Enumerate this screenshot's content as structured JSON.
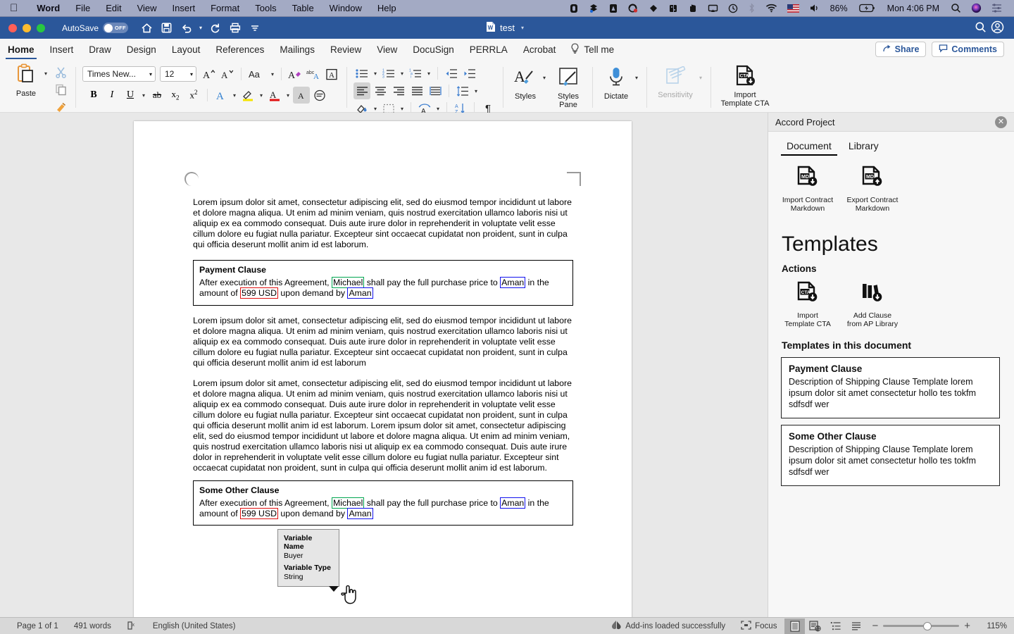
{
  "menubar": {
    "apple_icon": "apple-icon",
    "items": [
      {
        "label": "Word",
        "bold": true
      },
      {
        "label": "File",
        "bold": false
      },
      {
        "label": "Edit",
        "bold": false
      },
      {
        "label": "View",
        "bold": false
      },
      {
        "label": "Insert",
        "bold": false
      },
      {
        "label": "Format",
        "bold": false
      },
      {
        "label": "Tools",
        "bold": false
      },
      {
        "label": "Table",
        "bold": false
      },
      {
        "label": "Window",
        "bold": false
      },
      {
        "label": "Help",
        "bold": false
      }
    ],
    "status_icons": [
      "screen-recorder-icon",
      "dropbox-icon",
      "acrobat-icon",
      "cleanmymac-icon",
      "diamond-icon",
      "grid-icon",
      "evernote-icon",
      "airplay-icon",
      "time-machine-icon",
      "bluetooth-icon",
      "wifi-icon",
      "flag-us-icon",
      "volume-icon"
    ],
    "battery": "86%",
    "battery_icon": "battery-charging-icon",
    "clock": "Mon 4:06 PM",
    "spotlight_icon": "search-icon",
    "siri_icon": "siri-icon",
    "controlcenter_icon": "control-center-icon"
  },
  "titlebar": {
    "autosave_label": "AutoSave",
    "autosave_state": "OFF",
    "quick_access": [
      "home-icon",
      "save-icon",
      "undo-icon",
      "redo-icon",
      "print-icon",
      "more-icon"
    ],
    "document_name": "test",
    "document_icon": "word-document-icon",
    "search_icon": "search-icon",
    "account_icon": "account-icon",
    "bg_color": "#2b579a"
  },
  "ribbon_tabs": {
    "tabs": [
      {
        "label": "Home",
        "active": true
      },
      {
        "label": "Insert",
        "active": false
      },
      {
        "label": "Draw",
        "active": false
      },
      {
        "label": "Design",
        "active": false
      },
      {
        "label": "Layout",
        "active": false
      },
      {
        "label": "References",
        "active": false
      },
      {
        "label": "Mailings",
        "active": false
      },
      {
        "label": "Review",
        "active": false
      },
      {
        "label": "View",
        "active": false
      },
      {
        "label": "DocuSign",
        "active": false
      },
      {
        "label": "PERRLA",
        "active": false
      },
      {
        "label": "Acrobat",
        "active": false
      }
    ],
    "tell_me": "Tell me",
    "tell_me_icon": "lightbulb-icon",
    "share_label": "Share",
    "comments_label": "Comments"
  },
  "ribbon": {
    "paste_label": "Paste",
    "font_name": "Times New...",
    "font_size": "12",
    "styles_label": "Styles",
    "styles_pane_label": "Styles\nPane",
    "styles_pane_line1": "Styles",
    "styles_pane_line2": "Pane",
    "dictate_label": "Dictate",
    "sensitivity_label": "Sensitivity",
    "import_cta_line1": "Import",
    "import_cta_line2": "Template CTA"
  },
  "document": {
    "paragraphs": [
      "Lorem ipsum dolor sit amet, consectetur adipiscing elit, sed do eiusmod tempor incididunt ut labore et dolore magna aliqua. Ut enim ad minim veniam, quis nostrud exercitation ullamco laboris nisi ut aliquip ex ea commodo consequat. Duis aute irure dolor in reprehenderit in voluptate velit esse cillum dolore eu fugiat nulla pariatur. Excepteur sint occaecat cupidatat non proident, sunt in culpa qui officia deserunt mollit anim id est laborum.",
      "Lorem ipsum dolor sit amet, consectetur adipiscing elit, sed do eiusmod tempor incididunt ut labore et dolore magna aliqua. Ut enim ad minim veniam, quis nostrud exercitation ullamco laboris nisi ut aliquip ex ea commodo consequat. Duis aute irure dolor in reprehenderit in voluptate velit esse cillum dolore eu fugiat nulla pariatur. Excepteur sint occaecat cupidatat non proident, sunt in culpa qui officia deserunt mollit anim id est laborum",
      "Lorem ipsum dolor sit amet, consectetur adipiscing elit, sed do eiusmod tempor incididunt ut labore et dolore magna aliqua. Ut enim ad minim veniam, quis nostrud exercitation ullamco laboris nisi ut aliquip ex ea commodo consequat. Duis aute irure dolor in reprehenderit in voluptate velit esse cillum dolore eu fugiat nulla pariatur. Excepteur sint occaecat cupidatat non proident, sunt in culpa qui officia deserunt mollit anim id est laborum. Lorem ipsum dolor sit amet, consectetur adipiscing elit, sed do eiusmod tempor incididunt ut labore et dolore magna aliqua. Ut enim ad minim veniam, quis nostrud exercitation ullamco laboris nisi ut aliquip ex ea commodo consequat. Duis aute irure dolor in reprehenderit in voluptate velit esse cillum dolore eu fugiat nulla pariatur. Excepteur sint occaecat cupidatat non proident, sunt in culpa qui officia deserunt mollit anim id est laborum."
    ],
    "clause1": {
      "title": "Payment Clause",
      "t1": "After execution of this Agreement, ",
      "v1": "Michael",
      "t2": " shall pay the full purchase price to ",
      "v2": "Aman",
      "t3": " in the amount of ",
      "v3": "599 USD",
      "t4": " upon demand by ",
      "v4": "Aman"
    },
    "clause2": {
      "title": "Some Other Clause",
      "t1": "After execution of this Agreement, ",
      "v1": "Michael",
      "t2": " shall pay the full purchase price to ",
      "v2": "Aman",
      "t3": " in the amount of ",
      "v3": "599 USD",
      "t4": " upon demand by ",
      "v4": "Aman"
    },
    "variable_colors": {
      "party": "#1111ee",
      "buyer": "#00a550",
      "amount": "#e01010"
    }
  },
  "tooltip": {
    "name_label": "Variable Name",
    "name_value": "Buyer",
    "type_label": "Variable Type",
    "type_value": "String"
  },
  "taskpane": {
    "title": "Accord Project",
    "close_icon": "close-icon",
    "tabs": [
      {
        "label": "Document",
        "active": true
      },
      {
        "label": "Library",
        "active": false
      }
    ],
    "doc_actions": [
      {
        "line1": "Import Contract",
        "line2": "Markdown",
        "icon": "markdown-import-icon"
      },
      {
        "line1": "Export Contract",
        "line2": "Markdown",
        "icon": "markdown-export-icon"
      }
    ],
    "templates_title": "Templates",
    "actions_label": "Actions",
    "template_actions": [
      {
        "line1": "Import",
        "line2": "Template CTA",
        "icon": "cta-import-icon"
      },
      {
        "line1": "Add Clause",
        "line2": "from AP Library",
        "icon": "library-add-icon"
      }
    ],
    "in_document_label": "Templates in this document",
    "template_cards": [
      {
        "title": "Payment Clause",
        "description": "Description of Shipping Clause Template lorem ipsum dolor sit amet consectetur hollo tes tokfm sdfsdf wer"
      },
      {
        "title": "Some Other Clause",
        "description": "Description of Shipping Clause Template lorem ipsum dolor sit amet consectetur hollo tes tokfm sdfsdf wer"
      }
    ]
  },
  "statusbar": {
    "page_info": "Page 1 of 1",
    "word_count": "491 words",
    "proofing_icon": "proofing-icon",
    "language": "English (United States)",
    "addins_icon": "addins-icon",
    "addins_message": "Add-ins loaded successfully",
    "focus_icon": "focus-icon",
    "focus_label": "Focus",
    "view_buttons": [
      "print-layout-icon",
      "web-layout-icon",
      "outline-icon",
      "draft-icon"
    ],
    "zoom_out": "−",
    "zoom_in": "+",
    "zoom_level": "115%"
  }
}
